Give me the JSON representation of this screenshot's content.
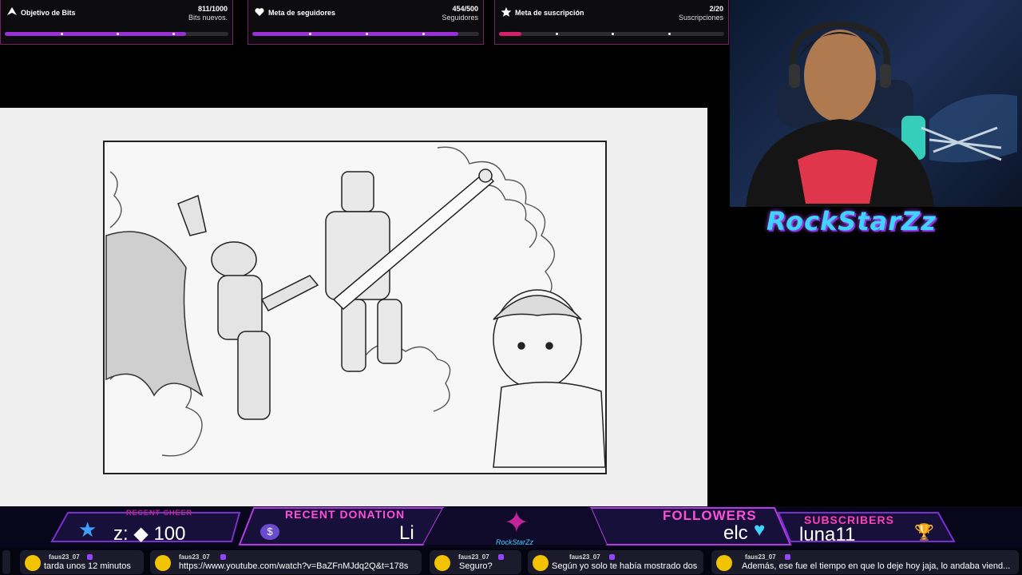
{
  "goals": [
    {
      "title": "Objetivo de Bits",
      "value": "811/1000",
      "sub": "Bits nuevos.",
      "progress": 0.811,
      "color": "#9b2fd6",
      "icon": "bits-icon"
    },
    {
      "title": "Meta de seguidores",
      "value": "454/500",
      "sub": "Seguidores",
      "progress": 0.908,
      "color": "#9b2fd6",
      "icon": "heart-follow-icon"
    },
    {
      "title": "Meta de suscripción",
      "value": "2/20",
      "sub": "Suscripciones",
      "progress": 0.1,
      "color": "#d61f6a",
      "icon": "star-sub-icon"
    }
  ],
  "brand": "RockStarZz",
  "bottom": {
    "recent_cheer": {
      "label": "RECENT CHEER",
      "value": "z: ◆ 100"
    },
    "recent_donation": {
      "label": "RECENT DONATION",
      "value": "Li"
    },
    "logo_text": "RockStarZz",
    "followers": {
      "label": "FOLLOWERS",
      "value": "elc"
    },
    "subscribers": {
      "label": "SUBSCRIBERS",
      "value": "luna11"
    }
  },
  "chat": [
    {
      "user": "faus23_07",
      "text": "tarda unos 12 minutos"
    },
    {
      "user": "faus23_07",
      "text": "https://www.youtube.com/watch?v=BaZFnMJdq2Q&t=178s"
    },
    {
      "user": "faus23_07",
      "text": "Seguro?"
    },
    {
      "user": "faus23_07",
      "text": "Según yo solo te había mostrado dos"
    },
    {
      "user": "faus23_07",
      "text": "Además, ese fue el tiempo en que lo deje hoy jaja, lo andaba viend..."
    }
  ],
  "colors": {
    "accent": "#9b2fd6",
    "pink": "#ff4fd8",
    "cyan": "#3fd3ff",
    "sub_fill": "#d61f6a"
  }
}
